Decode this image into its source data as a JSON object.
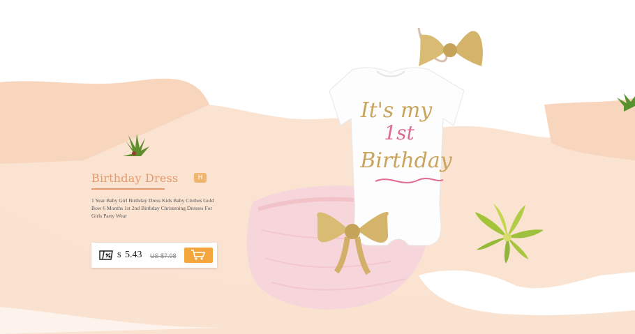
{
  "product": {
    "title": "Birthday Dress",
    "badge": "H",
    "description": "1 Year Baby Girl Birthday Dress Kids Baby Clothes Gold Bow 6 Months 1st 2nd Birthday Christening Dresses For Girls Party Wear",
    "currency": "$",
    "price": "5.43",
    "original_price": "US $7.98"
  },
  "onesie_print": {
    "line1": "It's my",
    "line2": "1st",
    "line3": "Birthday"
  },
  "icons": [
    "discount-icon",
    "add-to-cart-icon",
    "succulent-icon",
    "bow-icon"
  ],
  "colors": {
    "accent": "#e39a6c",
    "badge": "#f0b56f",
    "cart_button": "#f3a63b",
    "background_blob": "#f9dcc8"
  }
}
